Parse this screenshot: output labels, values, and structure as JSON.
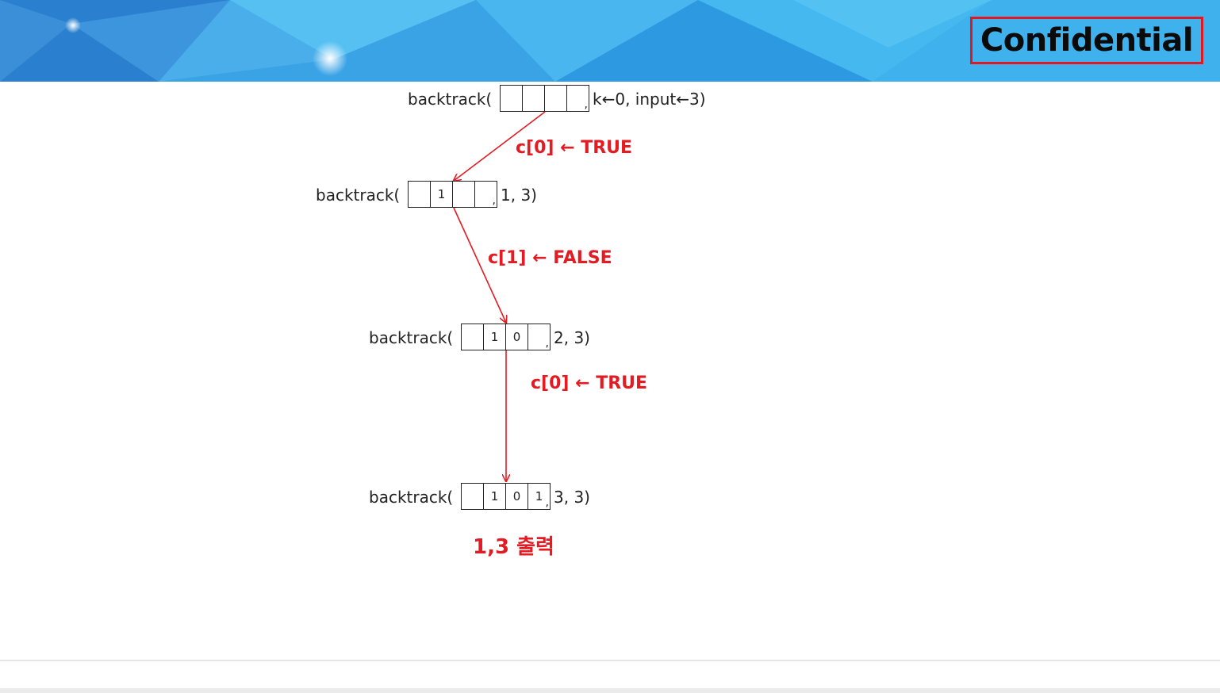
{
  "header": {
    "badge": "Confidential"
  },
  "nodes": [
    {
      "label": "backtrack(",
      "cells": [
        "",
        "",
        "",
        ""
      ],
      "args": "k←0, input←3)"
    },
    {
      "label": "backtrack(",
      "cells": [
        "",
        "1",
        "",
        ""
      ],
      "args": "1, 3)"
    },
    {
      "label": "backtrack(",
      "cells": [
        "",
        "1",
        "0",
        ""
      ],
      "args": "2, 3)"
    },
    {
      "label": "backtrack(",
      "cells": [
        "",
        "1",
        "0",
        "1"
      ],
      "args": "3, 3)"
    }
  ],
  "edges": [
    {
      "label": "c[0] ← TRUE"
    },
    {
      "label": "c[1] ← FALSE"
    },
    {
      "label": "c[0] ← TRUE"
    }
  ],
  "result": "1,3 출력",
  "colors": {
    "accent": "#e31b23",
    "banner": "#2fa9ec"
  }
}
